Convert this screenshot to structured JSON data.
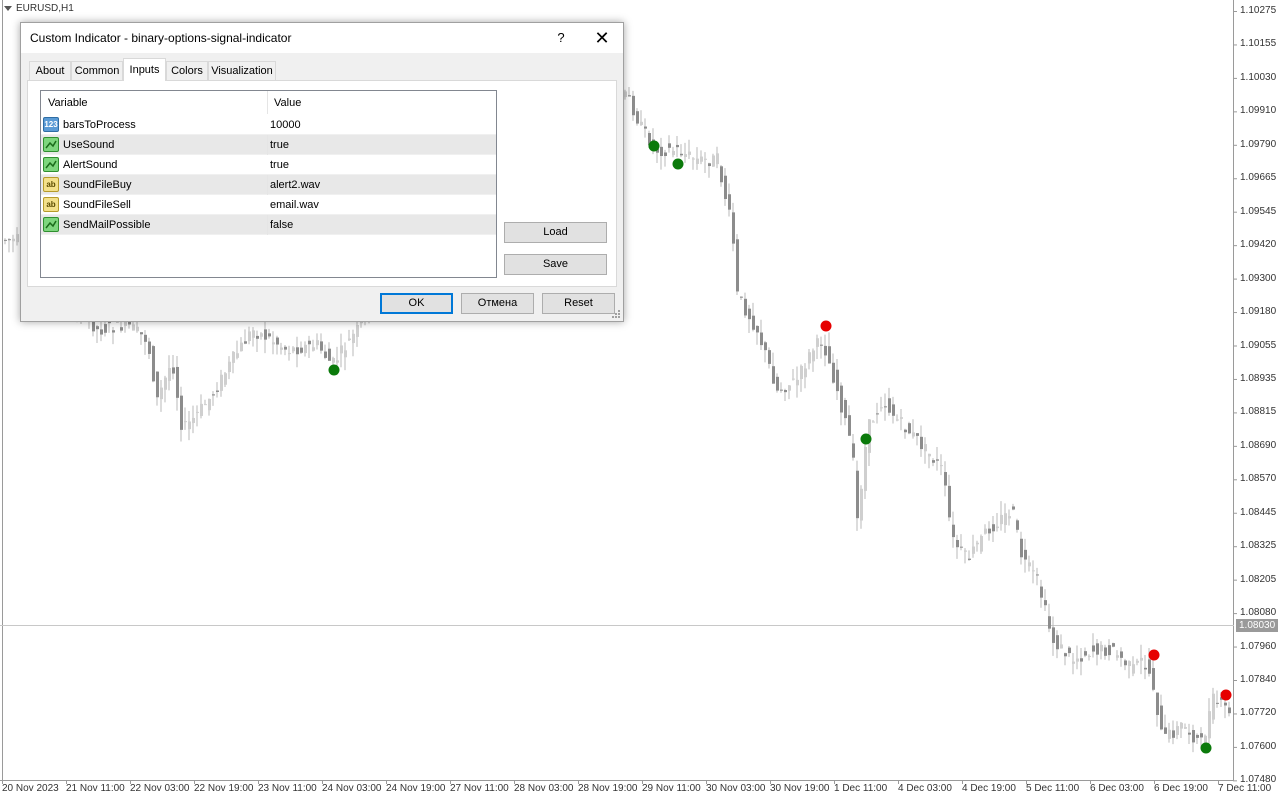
{
  "chart": {
    "symbol": "EURUSD,H1",
    "current_price": "1.08030",
    "price_axis": [
      "1.10275",
      "1.10155",
      "1.10030",
      "1.09910",
      "1.09790",
      "1.09665",
      "1.09545",
      "1.09420",
      "1.09300",
      "1.09180",
      "1.09055",
      "1.08935",
      "1.08815",
      "1.08690",
      "1.08570",
      "1.08445",
      "1.08325",
      "1.08205",
      "1.08080",
      "1.07960",
      "1.07840",
      "1.07720",
      "1.07600",
      "1.07480"
    ],
    "time_axis": [
      "20 Nov 2023",
      "21 Nov 11:00",
      "22 Nov 03:00",
      "22 Nov 19:00",
      "23 Nov 11:00",
      "24 Nov 03:00",
      "24 Nov 19:00",
      "27 Nov 11:00",
      "28 Nov 03:00",
      "28 Nov 19:00",
      "29 Nov 11:00",
      "30 Nov 03:00",
      "30 Nov 19:00",
      "1 Dec 11:00",
      "4 Dec 03:00",
      "4 Dec 19:00",
      "5 Dec 11:00",
      "6 Dec 03:00",
      "6 Dec 19:00",
      "7 Dec 11:00"
    ],
    "colors": {
      "candle": "#8c8c8c",
      "buy_signal": "#0b7a0b",
      "sell_signal": "#e60000",
      "grid_line": "#c8c8c8"
    }
  },
  "dialog": {
    "title": "Custom Indicator - binary-options-signal-indicator",
    "help_glyph": "?",
    "close_glyph": "✕",
    "tabs": [
      {
        "label": "About"
      },
      {
        "label": "Common"
      },
      {
        "label": "Inputs",
        "active": true
      },
      {
        "label": "Colors"
      },
      {
        "label": "Visualization"
      }
    ],
    "table": {
      "col_variable": "Variable",
      "col_value": "Value",
      "rows": [
        {
          "icon": "numeric-icon",
          "icon_text": "123",
          "variable": "barsToProcess",
          "value": "10000"
        },
        {
          "icon": "boolean-icon",
          "icon_text": "",
          "variable": "UseSound",
          "value": "true"
        },
        {
          "icon": "boolean-icon",
          "icon_text": "",
          "variable": "AlertSound",
          "value": "true"
        },
        {
          "icon": "string-icon",
          "icon_text": "ab",
          "variable": "SoundFileBuy",
          "value": "alert2.wav"
        },
        {
          "icon": "string-icon",
          "icon_text": "ab",
          "variable": "SoundFileSell",
          "value": "email.wav"
        },
        {
          "icon": "boolean-icon",
          "icon_text": "",
          "variable": "SendMailPossible",
          "value": "false"
        }
      ]
    },
    "buttons": {
      "load": "Load",
      "save": "Save",
      "ok": "OK",
      "cancel": "Отмена",
      "reset": "Reset"
    }
  }
}
